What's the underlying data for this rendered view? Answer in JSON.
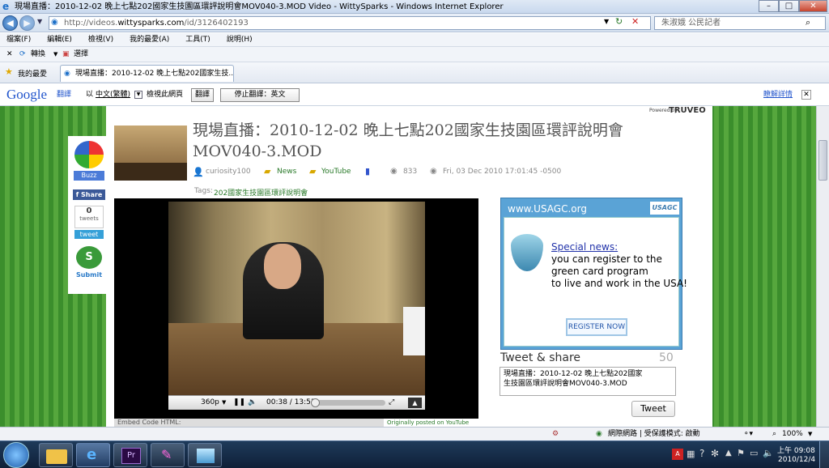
{
  "window": {
    "title": "現場直播：2010-12-02 晚上七點202國家生技園區環評說明會MOV040-3.MOD Video - WittySparks - Windows Internet Explorer",
    "minimize": "–",
    "maximize": "□",
    "close": "✕"
  },
  "address": {
    "url_prefix": "http://videos.",
    "url_domain": "wittysparks.com",
    "url_suffix": "/id/3126402193",
    "search_placeholder": "朱淑娥 公民記者"
  },
  "menu": [
    "檔案(F)",
    "編輯(E)",
    "檢視(V)",
    "我的最愛(A)",
    "工具(T)",
    "說明(H)"
  ],
  "commands": {
    "convert": "轉換",
    "select": "選擇"
  },
  "favorites": {
    "label": "我的最愛",
    "tab_title": "現場直播：2010-12-02 晚上七點202國家生技..."
  },
  "translate_bar": {
    "brand": "Google",
    "translate": "翻譯",
    "view_as_prefix": "以",
    "language": "中文(繁體)",
    "view_suffix": "檢視此網頁",
    "translate_button": "翻譯",
    "stop_button": "停止翻譯：英文",
    "about": "瞭解詳情"
  },
  "video_page": {
    "powered_by": "Powered by",
    "powered_brand": "TRUVEO",
    "title_line1": "現場直播：2010-12-02 晚上七點202國家生技園區環評說明會",
    "title_line2": "MOV040-3.MOD",
    "author": "curiosity100",
    "category": "News",
    "source": "YouTube",
    "views": "833",
    "date": "Fri, 03 Dec 2010 17:01:45 -0500",
    "tags_label": "Tags:",
    "tag": "202國家生技園區環評說明會",
    "embed_label": "Embed Code HTML:",
    "originally": "Originally posted on YouTube"
  },
  "share_sidebar": {
    "buzz": "Buzz",
    "share": "Share",
    "tweets_count": "0",
    "tweets_label": "tweets",
    "tweet": "tweet",
    "submit": "Submit"
  },
  "player": {
    "quality": "360p",
    "time": "00:38 / 13:53",
    "progress_fraction": 0.05
  },
  "ad": {
    "site": "www.USAGC.org",
    "logo": "USAGC",
    "headline": "Special news:",
    "line1": "you can register to the",
    "line2": "green card program",
    "line3": "to live and work in the USA!",
    "cta": "REGISTER NOW"
  },
  "tweet_share": {
    "heading": "Tweet & share",
    "count": "50",
    "text_line1": "現場直播：2010-12-02 晚上七點202國家",
    "text_line2": "生技園區環評說明會MOV040-3.MOD",
    "button": "Tweet"
  },
  "status": {
    "zone": "網際網路 | 受保護模式: 啟動",
    "zoom": "100%"
  },
  "taskbar": {
    "time": "上午 09:08",
    "date": "2010/12/4"
  },
  "colors": {
    "accent": "#1c6fc8",
    "green_bg": "#3b8e2c",
    "ad_blue": "#5aa3d6"
  }
}
